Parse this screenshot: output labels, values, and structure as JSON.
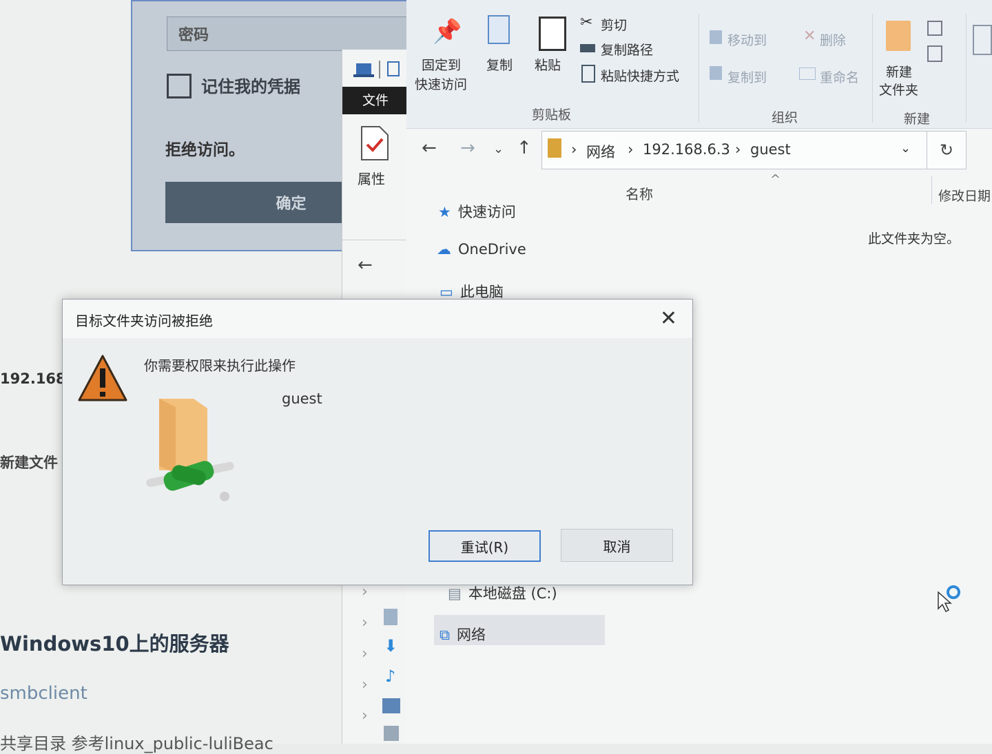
{
  "background_page": {
    "ip_fragment": "192.168.",
    "new_file_fragment": "新建文件",
    "heading_fragment": "Windows10上的服务器",
    "cmd_fragment": "smbclient",
    "footer_fragment": "共享目录    参考linux_public-luliBeac"
  },
  "login_dialog": {
    "password_placeholder": "密码",
    "remember_label": "记住我的凭据",
    "error_text": "拒绝访问。",
    "ok_label": "确定"
  },
  "properties_window": {
    "tab_label": "文件",
    "properties_label": "属性"
  },
  "ribbon": {
    "pin_label_1": "固定到",
    "pin_label_2": "快速访问",
    "copy_label": "复制",
    "paste_label": "粘贴",
    "cut_label": "剪切",
    "copy_path_label": "复制路径",
    "paste_shortcut_label": "粘贴快捷方式",
    "clipboard_group": "剪贴板",
    "move_to_label": "移动到",
    "delete_label": "删除",
    "copy_to_label": "复制到",
    "rename_label": "重命名",
    "organize_group": "组织",
    "new_folder_label_1": "新建",
    "new_folder_label_2": "文件夹",
    "new_group": "新建"
  },
  "address": {
    "crumbs": [
      "网络",
      "192.168.6.3",
      "guest"
    ]
  },
  "file_list": {
    "col_name": "名称",
    "col_modified": "修改日期",
    "empty_text": "此文件夹为空。"
  },
  "nav_tree": {
    "quick_access": "快速访问",
    "onedrive": "OneDrive",
    "this_pc": "此电脑",
    "local_disk": "本地磁盘 (C:)",
    "network": "网络"
  },
  "modal": {
    "title": "目标文件夹访问被拒绝",
    "message": "你需要权限来执行此操作",
    "folder_name": "guest",
    "retry_label": "重试(R)",
    "cancel_label": "取消"
  },
  "colors": {
    "accent": "#3f7fcf",
    "warning": "#e07b2a"
  }
}
